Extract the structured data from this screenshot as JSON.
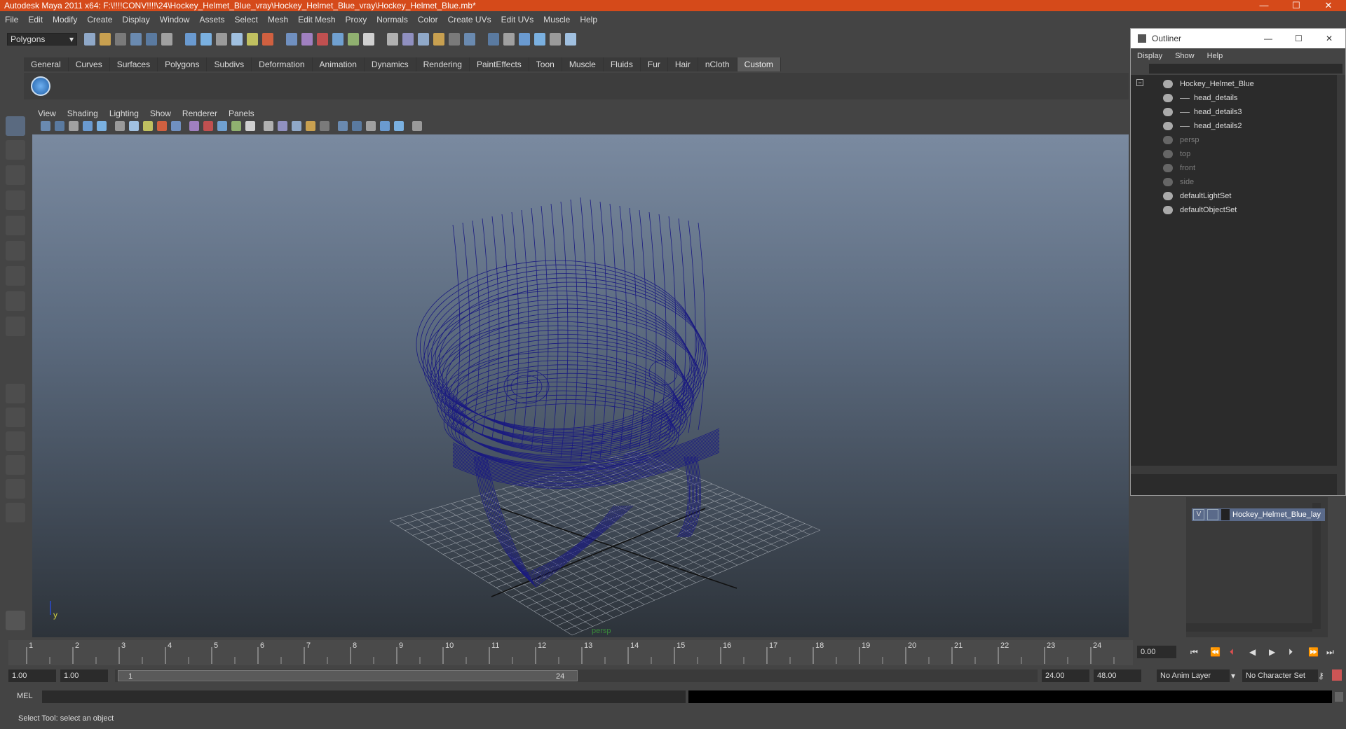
{
  "window": {
    "title": "Autodesk Maya 2011 x64: F:\\!!!!CONV!!!!\\24\\Hockey_Helmet_Blue_vray\\Hockey_Helmet_Blue_vray\\Hockey_Helmet_Blue.mb*"
  },
  "menubar": [
    "File",
    "Edit",
    "Modify",
    "Create",
    "Display",
    "Window",
    "Assets",
    "Select",
    "Mesh",
    "Edit Mesh",
    "Proxy",
    "Normals",
    "Color",
    "Create UVs",
    "Edit UVs",
    "Muscle",
    "Help"
  ],
  "mode_selector": {
    "value": "Polygons"
  },
  "shelf_tabs": [
    "General",
    "Curves",
    "Surfaces",
    "Polygons",
    "Subdivs",
    "Deformation",
    "Animation",
    "Dynamics",
    "Rendering",
    "PaintEffects",
    "Toon",
    "Muscle",
    "Fluids",
    "Fur",
    "Hair",
    "nCloth",
    "Custom"
  ],
  "shelf_active": "Custom",
  "viewport": {
    "menu": [
      "View",
      "Shading",
      "Lighting",
      "Show",
      "Renderer",
      "Panels"
    ],
    "camera_label": "persp",
    "axis_label": "y"
  },
  "outliner": {
    "title": "Outliner",
    "menu": [
      "Display",
      "Show",
      "Help"
    ],
    "items": [
      {
        "label": "Hockey_Helmet_Blue",
        "dim": false,
        "level": 0
      },
      {
        "label": "head_details",
        "dim": false,
        "level": 1
      },
      {
        "label": "head_details3",
        "dim": false,
        "level": 1
      },
      {
        "label": "head_details2",
        "dim": false,
        "level": 1
      },
      {
        "label": "persp",
        "dim": true,
        "level": 0
      },
      {
        "label": "top",
        "dim": true,
        "level": 0
      },
      {
        "label": "front",
        "dim": true,
        "level": 0
      },
      {
        "label": "side",
        "dim": true,
        "level": 0
      },
      {
        "label": "defaultLightSet",
        "dim": false,
        "level": 0
      },
      {
        "label": "defaultObjectSet",
        "dim": false,
        "level": 0
      }
    ]
  },
  "layers": {
    "visible_flag": "V",
    "name": "Hockey_Helmet_Blue_lay"
  },
  "timeline": {
    "ticks": [
      "1",
      "2",
      "3",
      "4",
      "5",
      "6",
      "7",
      "8",
      "9",
      "10",
      "11",
      "12",
      "13",
      "14",
      "15",
      "16",
      "17",
      "18",
      "19",
      "20",
      "21",
      "22",
      "23",
      "24"
    ],
    "current_time": "0.00"
  },
  "range": {
    "start": "1.00",
    "playback_start": "1.00",
    "slider_start": "1",
    "slider_end": "24",
    "playback_end": "24.00",
    "end": "48.00",
    "anim_layer": "No Anim Layer",
    "character_set": "No Character Set"
  },
  "command_line": {
    "label": "MEL"
  },
  "status": {
    "message": "Select Tool: select an object"
  },
  "colors": {
    "titlebar": "#d54a1a",
    "wireframe": "#1a1a80",
    "panel": "#444444"
  }
}
